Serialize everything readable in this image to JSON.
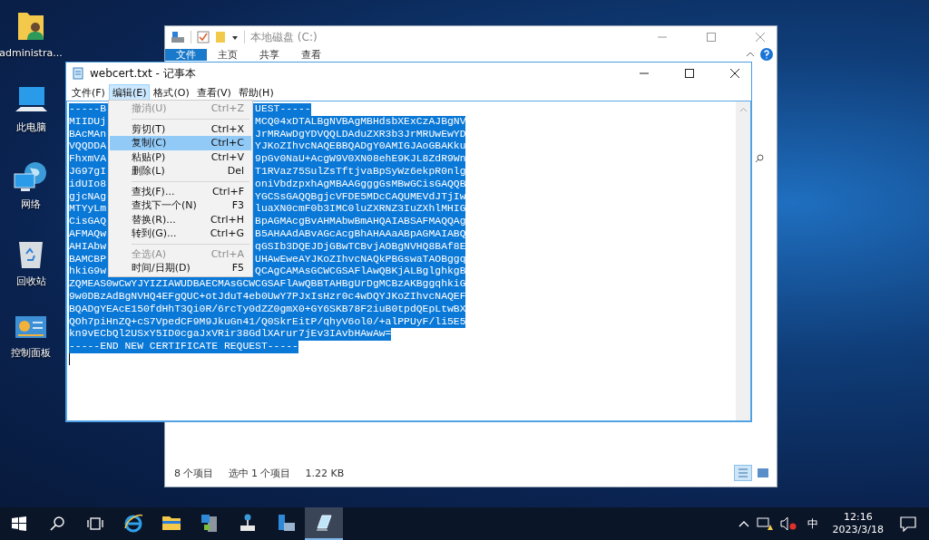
{
  "desktop_icons": [
    {
      "kind": "user-folder",
      "label": "administra..."
    },
    {
      "kind": "computer",
      "label": "此电脑"
    },
    {
      "kind": "network",
      "label": "网络"
    },
    {
      "kind": "recycle-bin",
      "label": "回收站"
    },
    {
      "kind": "control-panel",
      "label": "控制面板"
    }
  ],
  "explorer": {
    "title": "本地磁盘 (C:)",
    "ribbon_tabs": [
      {
        "label": "文件",
        "selected": true
      },
      {
        "label": "主页",
        "selected": false
      },
      {
        "label": "共享",
        "selected": false
      },
      {
        "label": "查看",
        "selected": false
      }
    ],
    "status": {
      "item_count": "8 个项目",
      "selection": "选中 1 个项目",
      "size": "1.22 KB"
    },
    "view_buttons": [
      {
        "kind": "details",
        "selected": true
      },
      {
        "kind": "large-icons",
        "selected": false
      }
    ]
  },
  "notepad": {
    "title": "webcert.txt - 记事本",
    "menu": [
      {
        "label": "文件(F)",
        "selected": false
      },
      {
        "label": "编辑(E)",
        "selected": true
      },
      {
        "label": "格式(O)",
        "selected": false
      },
      {
        "label": "查看(V)",
        "selected": false
      },
      {
        "label": "帮助(H)",
        "selected": false
      }
    ],
    "edit_menu": [
      {
        "kind": "item",
        "label": "撤消(U)",
        "shortcut": "Ctrl+Z",
        "disabled": true,
        "selected": false
      },
      {
        "kind": "separator"
      },
      {
        "kind": "item",
        "label": "剪切(T)",
        "shortcut": "Ctrl+X",
        "disabled": false,
        "selected": false
      },
      {
        "kind": "item",
        "label": "复制(C)",
        "shortcut": "Ctrl+C",
        "disabled": false,
        "selected": true
      },
      {
        "kind": "item",
        "label": "粘贴(P)",
        "shortcut": "Ctrl+V",
        "disabled": false,
        "selected": false
      },
      {
        "kind": "item",
        "label": "删除(L)",
        "shortcut": "Del",
        "disabled": false,
        "selected": false
      },
      {
        "kind": "separator"
      },
      {
        "kind": "item",
        "label": "查找(F)...",
        "shortcut": "Ctrl+F",
        "disabled": false,
        "selected": false
      },
      {
        "kind": "item",
        "label": "查找下一个(N)",
        "shortcut": "F3",
        "disabled": false,
        "selected": false
      },
      {
        "kind": "item",
        "label": "替换(R)...",
        "shortcut": "Ctrl+H",
        "disabled": false,
        "selected": false
      },
      {
        "kind": "item",
        "label": "转到(G)...",
        "shortcut": "Ctrl+G",
        "disabled": false,
        "selected": false
      },
      {
        "kind": "separator"
      },
      {
        "kind": "item",
        "label": "全选(A)",
        "shortcut": "Ctrl+A",
        "disabled": true,
        "selected": false
      },
      {
        "kind": "item",
        "label": "时间/日期(D)",
        "shortcut": "F5",
        "disabled": false,
        "selected": false
      }
    ],
    "lines": [
      {
        "kind": "split",
        "start": "-----B",
        "end": "UEST-----",
        "selected": true
      },
      {
        "kind": "split",
        "start": "MIIDUj",
        "end": "MCQ04xDTALBgNVBAgMBHdsbXExCzAJBgNV",
        "selected": true
      },
      {
        "kind": "split",
        "start": "BAcMAn",
        "end": "JrMRAwDgYDVQQLDAduZXR3b3JrMRUwEwYD",
        "selected": true
      },
      {
        "kind": "split",
        "start": "VQQDDA",
        "end": "YJKoZIhvcNAQEBBQADgY0AMIGJAoGBAKku",
        "selected": true
      },
      {
        "kind": "split",
        "start": "FhxmVA",
        "end": "9pGv0NaU+AcgW9V0XN08ehE9KJL8ZdR9Wn",
        "selected": true
      },
      {
        "kind": "split",
        "start": "JG97gI",
        "end": "T1RVaz75SulZsTftjvaBpSyWz6ekpR0nlg",
        "selected": true
      },
      {
        "kind": "split",
        "start": "idUIo8",
        "end": "oniVbdzpxhAgMBAAGgggGsMBwGCisGAQQB",
        "selected": true
      },
      {
        "kind": "split",
        "start": "gjcNAg",
        "end": "YGCSsGAQQBgjcVFDE5MDcCAQUMEVdJTjIw",
        "selected": true
      },
      {
        "kind": "split",
        "start": "MTYyLm",
        "end": "luaXN0cmF0b3IMC0luZXRNZ3IuZXhlMHIG",
        "selected": true
      },
      {
        "kind": "split",
        "start": "CisGAQ",
        "end": "BpAGMAcgBvAHMAbwBmAHQAIABSAFMAQQAg",
        "selected": true
      },
      {
        "kind": "split",
        "start": "AFMAQw",
        "end": "B5AHAAdABvAGcAcgBhAHAAaABpAGMAIABQ",
        "selected": true
      },
      {
        "kind": "split",
        "start": "AHIAbw",
        "end": "qGSIb3DQEJDjGBwTCBvjAOBgNVHQ8BAf8E",
        "selected": true
      },
      {
        "kind": "split",
        "start": "BAMCBP",
        "end": "UHAwEweAYJKoZIhvcNAQkPBGswaTAOBggq",
        "selected": true
      },
      {
        "kind": "split",
        "start": "hkiG9w",
        "end": "QCAgCAMAsGCWCGSAFlAwQBKjALBglghkgB",
        "selected": true
      },
      {
        "kind": "full",
        "text": "ZQMEAS0wCwYJYIZIAWUDBAECMAsGCWCGSAFlAwQBBTAHBgUrDgMCBzAKBggqhkiG",
        "selected": true
      },
      {
        "kind": "full",
        "text": "9w0DBzAdBgNVHQ4EFgQUC+otJduT4eb0UwY7PJxIsHzr0c4wDQYJKoZIhvcNAQEF",
        "selected": true
      },
      {
        "kind": "full",
        "text": "BQADgYEAcE150fdHhT3Qi0R/6rcTy0dZZ0gmX0+GY6SKB78F2iuB0tpdQEpLtwBX",
        "selected": true
      },
      {
        "kind": "full",
        "text": "QOh7piHnZQ+cS7VpedCF9M9JkuGn41/Q0SkrEitP/qhyV6ol0/+alPPUyF/li5E5",
        "selected": true
      },
      {
        "kind": "full",
        "text": "kn9vECbQl2USxY5ID0cgaJxVRir38GdlXArur7jEv3IAvbHAwAw=",
        "selected": true
      },
      {
        "kind": "full",
        "text": "-----END NEW CERTIFICATE REQUEST-----",
        "selected": true
      }
    ]
  },
  "taskbar": {
    "apps": [
      {
        "kind": "ie",
        "selected": false
      },
      {
        "kind": "folder",
        "selected": false
      },
      {
        "kind": "server",
        "selected": false
      },
      {
        "kind": "network",
        "selected": false
      },
      {
        "kind": "manager",
        "selected": false
      },
      {
        "kind": "notepad",
        "selected": true
      }
    ],
    "ime": "中",
    "time": "12:16",
    "date": "2023/3/18"
  }
}
